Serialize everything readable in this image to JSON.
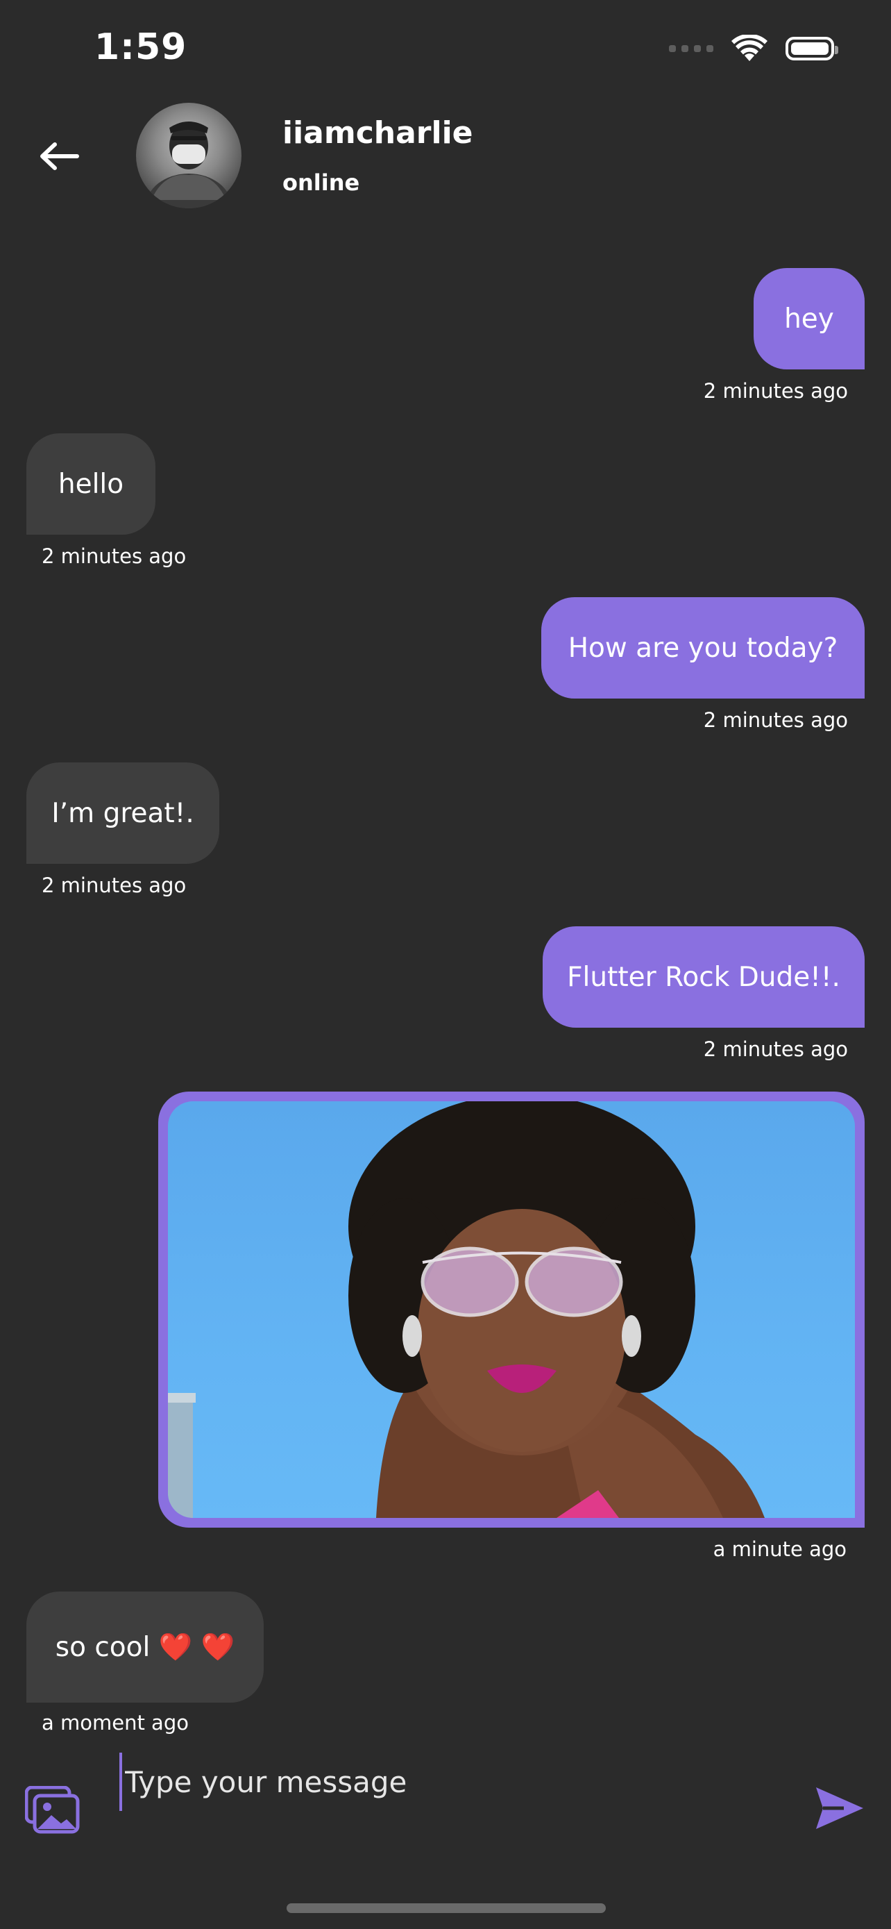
{
  "status_bar": {
    "time": "1:59"
  },
  "header": {
    "name": "iiamcharlie",
    "status": "online"
  },
  "messages": [
    {
      "id": "m1",
      "side": "out",
      "text": "hey",
      "time": "2 minutes ago"
    },
    {
      "id": "m2",
      "side": "in",
      "text": "hello",
      "time": "2 minutes ago"
    },
    {
      "id": "m3",
      "side": "out",
      "text": "How are you today?",
      "time": "2 minutes ago"
    },
    {
      "id": "m4",
      "side": "in",
      "text": "I’m great!.",
      "time": "2 minutes ago"
    },
    {
      "id": "m5",
      "side": "out",
      "text": "Flutter Rock Dude!!.",
      "time": "2 minutes ago"
    },
    {
      "id": "m6",
      "side": "out",
      "type": "image",
      "time": "a minute ago"
    },
    {
      "id": "m7",
      "side": "in",
      "text": "so cool ❤️ ❤️",
      "time": "a moment ago"
    }
  ],
  "composer": {
    "placeholder": "Type your message"
  },
  "colors": {
    "accent": "#8a70e0",
    "background": "#2b2b2b",
    "incoming_bubble": "#3e3e3e"
  },
  "icons": {
    "back": "arrow-left-icon",
    "gallery": "gallery-icon",
    "send": "send-icon",
    "wifi": "wifi-icon",
    "battery": "battery-icon"
  }
}
